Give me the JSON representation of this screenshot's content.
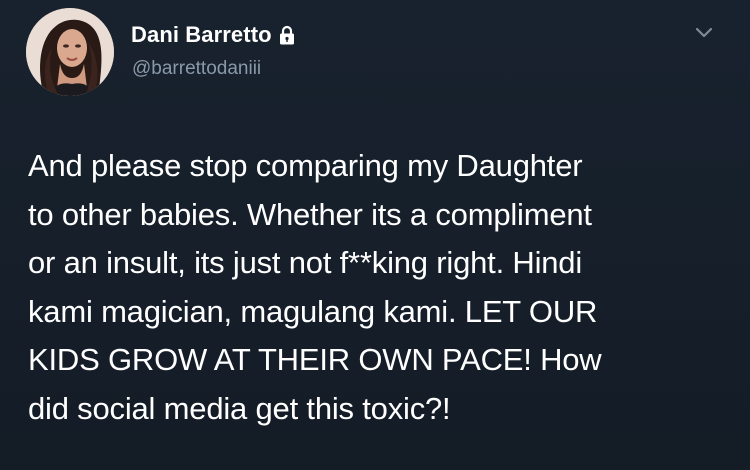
{
  "tweet": {
    "display_name": "Dani Barretto",
    "handle": "@barrettodaniii",
    "protected_icon": "lock-icon",
    "menu_icon": "chevron-down-icon",
    "text_lines": [
      "And please stop comparing my Daughter",
      "to other babies. Whether its a compliment",
      "or an insult, its just not f**king right. Hindi",
      "kami magician, magulang kami. LET OUR",
      "KIDS GROW AT THEIR OWN PACE! How",
      "did social media get this toxic?!"
    ]
  },
  "colors": {
    "background": "#15202b",
    "text": "#ffffff",
    "secondary_text": "#8a99a8"
  }
}
